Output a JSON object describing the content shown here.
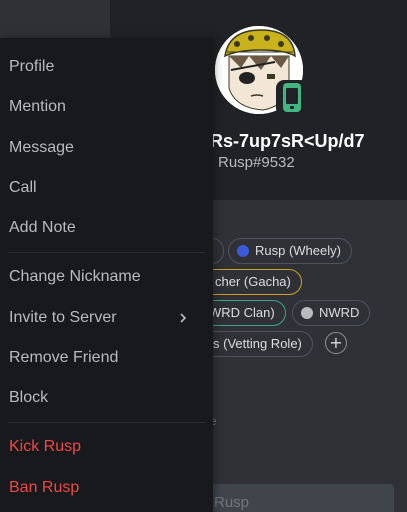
{
  "menu": {
    "items": [
      {
        "label": "Profile"
      },
      {
        "label": "Mention"
      },
      {
        "label": "Message"
      },
      {
        "label": "Call"
      },
      {
        "label": "Add Note"
      },
      {
        "label": "Change Nickname"
      },
      {
        "label": "Invite to Server"
      },
      {
        "label": "Remove Friend"
      },
      {
        "label": "Block"
      },
      {
        "label": "Kick Rusp"
      },
      {
        "label": "Ban Rusp"
      }
    ],
    "danger_color": "#f04747"
  },
  "profile": {
    "username": "Rs-7up7sR<Up/d7",
    "tag": "Rusp#9532",
    "status": "mobile-online",
    "status_color": "#43b581",
    "roles": [
      {
        "label": "Rusp (Wheely)",
        "color": "#3b5bdb"
      },
      {
        "label": "cher (Gacha)",
        "color": "#c9a227"
      },
      {
        "label": "WRD Clan)",
        "color": "#3ba58a"
      },
      {
        "label": "NWRD",
        "color": "#b9bbbe"
      },
      {
        "label": "s (Vetting Role)",
        "color": "#4f545c"
      }
    ],
    "add_role_symbol": "+",
    "note_placeholder": "ote",
    "message_placeholder": "Rusp"
  }
}
